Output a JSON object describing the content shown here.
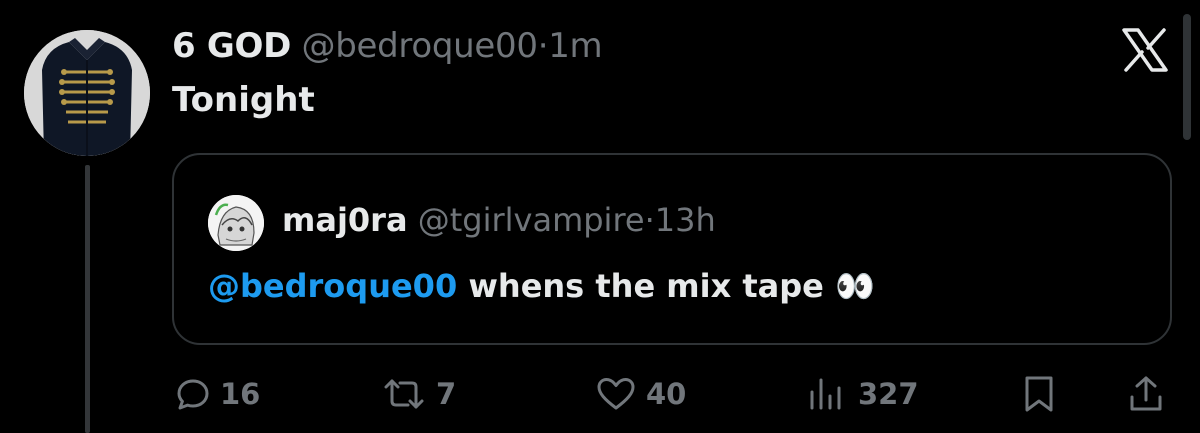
{
  "tweet": {
    "display_name": "6 GOD",
    "handle": "@bedroque00",
    "separator": "·",
    "time": "1m",
    "text": "Tonight"
  },
  "quoted_tweet": {
    "display_name": "maj0ra",
    "handle": "@tgirlvampire",
    "separator": "·",
    "time": "13h",
    "mention": "@bedroque00",
    "text": "whens the mix tape",
    "emoji": "👀"
  },
  "actions": {
    "replies": "16",
    "retweets": "7",
    "likes": "40",
    "views": "327"
  },
  "icons": [
    "x-logo-icon",
    "reply-icon",
    "retweet-icon",
    "like-icon",
    "views-icon",
    "bookmark-icon",
    "share-icon"
  ],
  "colors": {
    "background": "#000000",
    "primary_text": "#e7e9ea",
    "secondary_text": "#71767b",
    "mention": "#1d9bf0",
    "border": "#2f3336"
  }
}
